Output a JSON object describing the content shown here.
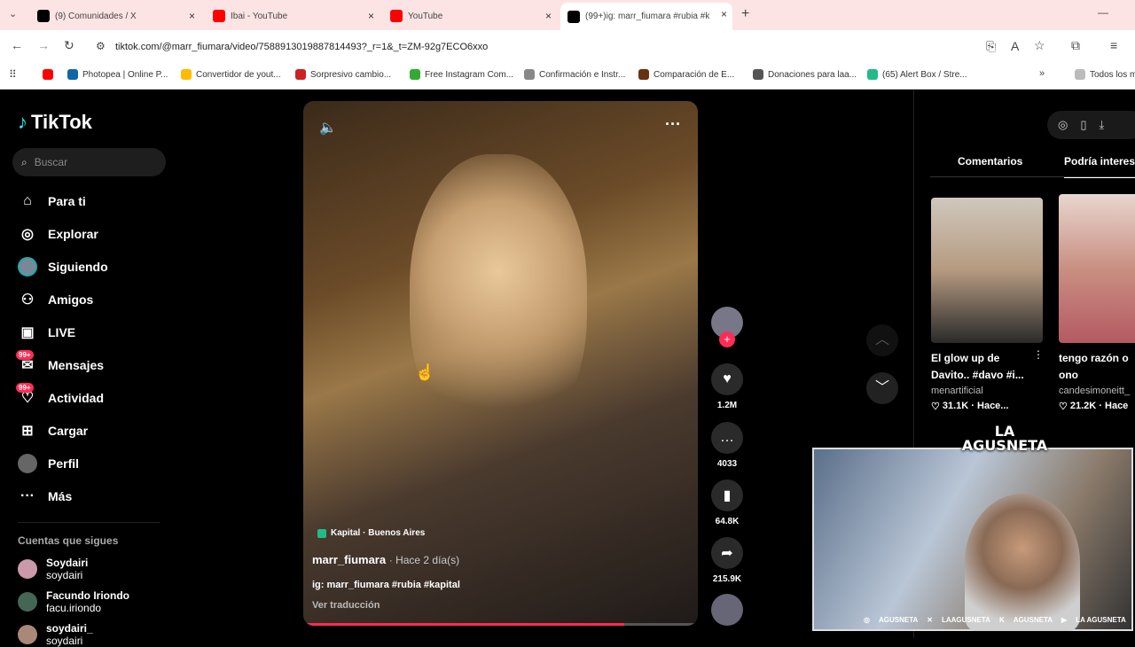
{
  "browser": {
    "tabs": [
      {
        "title": "(9) Comunidades / X",
        "icon": "x-logo-icon"
      },
      {
        "title": "Ibai - YouTube",
        "icon": "youtube-icon"
      },
      {
        "title": "YouTube",
        "icon": "youtube-icon"
      },
      {
        "title": "(99+)ig: marr_fiumara #rubia #k",
        "icon": "tiktok-icon"
      }
    ],
    "url": "tiktok.com/@marr_fiumara/video/7588913019887814493?_r=1&_t=ZM-92g7ECO6xxo",
    "bookmarks": [
      "Photopea | Online P...",
      "Convertidor de yout...",
      "Sorpresivo cambio...",
      "Free Instagram Com...",
      "Confirmación e Instr...",
      "Comparación de E...",
      "Donaciones para laa...",
      "(65) Alert Box / Stre...",
      "Todos los m"
    ]
  },
  "sidebar": {
    "logo": "TikTok",
    "search_placeholder": "Buscar",
    "nav": [
      {
        "label": "Para ti",
        "icon": "home-icon"
      },
      {
        "label": "Explorar",
        "icon": "compass-icon"
      },
      {
        "label": "Siguiendo",
        "icon": "avatar-icon"
      },
      {
        "label": "Amigos",
        "icon": "friends-icon"
      },
      {
        "label": "LIVE",
        "icon": "live-icon"
      },
      {
        "label": "Mensajes",
        "icon": "message-icon",
        "badge": "99+"
      },
      {
        "label": "Actividad",
        "icon": "activity-icon",
        "badge": "99+"
      },
      {
        "label": "Cargar",
        "icon": "upload-icon"
      },
      {
        "label": "Perfil",
        "icon": "profile-icon"
      },
      {
        "label": "Más",
        "icon": "more-icon"
      }
    ],
    "following_title": "Cuentas que sigues",
    "following": [
      {
        "name": "Soydairi",
        "handle": "soydairi"
      },
      {
        "name": "Facundo Iriondo",
        "handle": "facu.iriondo"
      },
      {
        "name": "soydairi_",
        "handle": "soydairi"
      }
    ]
  },
  "video": {
    "location": "Kapital · Buenos Aires",
    "author": "marr_fiumara",
    "time": "· Hace 2 día(s)",
    "caption": "ig: marr_fiumara #rubia #kapital",
    "translate": "Ver traducción",
    "progress": 0.82
  },
  "actions": {
    "likes": "1.2M",
    "comments": "4033",
    "saves": "64.8K",
    "shares": "215.9K"
  },
  "right_panel": {
    "tabs": [
      "Comentarios",
      "Podría interes"
    ],
    "cards": [
      {
        "title1": "El glow up de",
        "title2": "Davito.. #davo #i...",
        "author": "menartificial",
        "stats": "31.1K · Hace..."
      },
      {
        "title1": "tengo razón o",
        "title2": "ono",
        "author": "candesimoneitt_",
        "stats": "21.2K · Hace"
      }
    ]
  },
  "overlay": {
    "brand": "LA AGUSNETA",
    "socials": [
      "AGUSNETA",
      "LAAGUSNETA",
      "AGUSNETA",
      "LA AGUSNETA"
    ]
  },
  "colors": {
    "accent": "#fe2c55",
    "bg": "#000000"
  }
}
